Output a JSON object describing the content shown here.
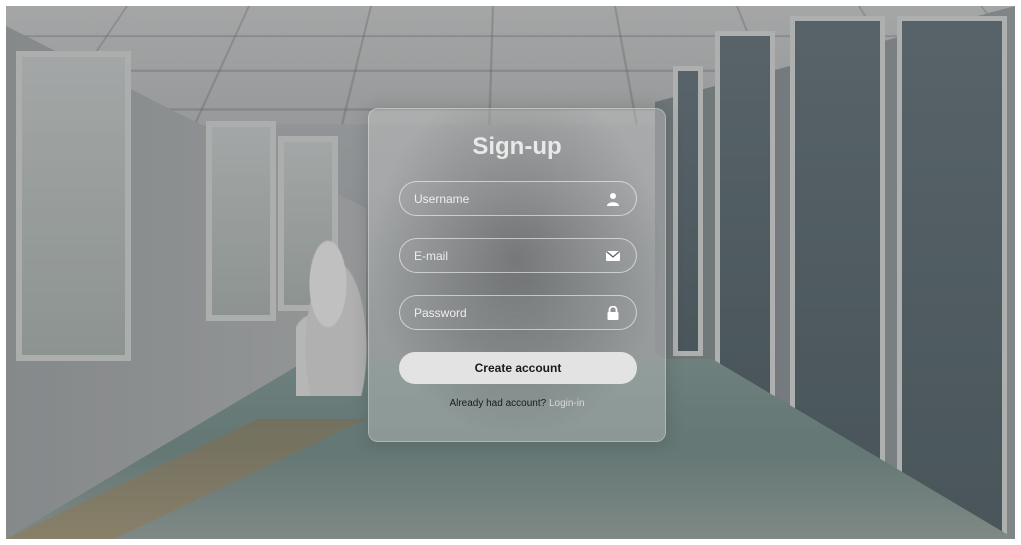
{
  "form": {
    "title": "Sign-up",
    "username": {
      "placeholder": "Username",
      "icon": "user-icon"
    },
    "email": {
      "placeholder": "E-mail",
      "icon": "envelope-icon"
    },
    "password": {
      "placeholder": "Password",
      "icon": "lock-icon"
    },
    "submit_label": "Create account",
    "footer_text": "Already had account?",
    "login_link": "Login-in"
  },
  "colors": {
    "title": "#e9e9e9",
    "button_bg": "#e3e3e3",
    "button_text": "#1a1a1a",
    "link": "#d8d8d8"
  }
}
